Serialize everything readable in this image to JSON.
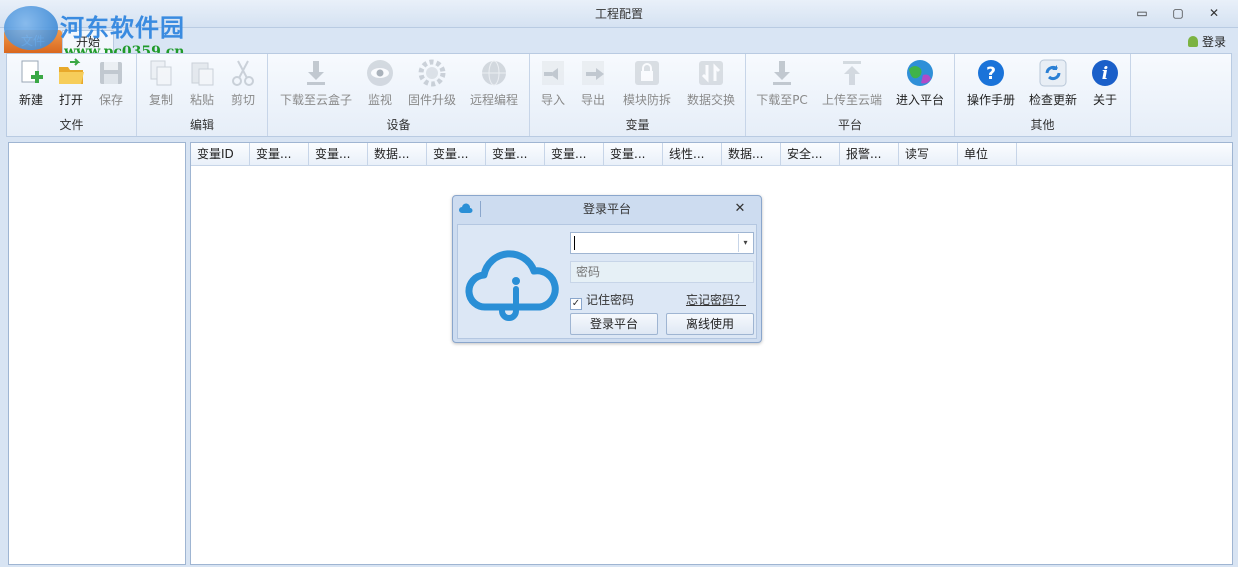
{
  "window": {
    "title": "工程配置",
    "controls": {
      "minimize": "▭",
      "maximize": "▢",
      "close": "✕"
    }
  },
  "watermark": {
    "title": "河东软件园",
    "url": "www.pc0359.cn"
  },
  "tabs": {
    "file": "文件",
    "home": "开始"
  },
  "login_link": "登录",
  "ribbon": {
    "groups": [
      {
        "label": "文件",
        "buttons": [
          {
            "label": "新建",
            "icon": "new-doc-icon"
          },
          {
            "label": "打开",
            "icon": "folder-open-icon"
          },
          {
            "label": "保存",
            "icon": "save-icon"
          }
        ]
      },
      {
        "label": "编辑",
        "buttons": [
          {
            "label": "复制",
            "icon": "copy-icon"
          },
          {
            "label": "粘贴",
            "icon": "paste-icon"
          },
          {
            "label": "剪切",
            "icon": "scissors-icon"
          }
        ]
      },
      {
        "label": "设备",
        "buttons": [
          {
            "label": "下载至云盒子",
            "icon": "download-icon"
          },
          {
            "label": "监视",
            "icon": "eye-icon"
          },
          {
            "label": "固件升级",
            "icon": "gear-icon"
          },
          {
            "label": "远程编程",
            "icon": "globe-icon"
          }
        ]
      },
      {
        "label": "变量",
        "buttons": [
          {
            "label": "导入",
            "icon": "import-icon"
          },
          {
            "label": "导出",
            "icon": "export-icon"
          },
          {
            "label": "模块防拆",
            "icon": "lock-icon"
          },
          {
            "label": "数据交换",
            "icon": "exchange-icon"
          }
        ]
      },
      {
        "label": "平台",
        "buttons": [
          {
            "label": "下载至PC",
            "icon": "download-icon"
          },
          {
            "label": "上传至云端",
            "icon": "upload-icon"
          },
          {
            "label": "进入平台",
            "icon": "platform-icon"
          }
        ]
      },
      {
        "label": "其他",
        "buttons": [
          {
            "label": "操作手册",
            "icon": "help-icon"
          },
          {
            "label": "检查更新",
            "icon": "refresh-icon"
          },
          {
            "label": "关于",
            "icon": "info-icon"
          }
        ]
      }
    ]
  },
  "grid": {
    "columns": [
      "变量ID",
      "变量...",
      "变量...",
      "数据...",
      "变量...",
      "变量...",
      "变量...",
      "变量...",
      "线性...",
      "数据...",
      "安全...",
      "报警...",
      "读写",
      "单位"
    ]
  },
  "login_dialog": {
    "title": "登录平台",
    "close": "✕",
    "username_value": "",
    "password_placeholder": "密码",
    "remember_label": "记住密码",
    "remember_checked": true,
    "check_mark": "✓",
    "forgot_label": "忘记密码？",
    "login_button": "登录平台",
    "offline_button": "离线使用",
    "dropdown_arrow": "▾"
  },
  "colors": {
    "file_tab": "#e37a2e",
    "cloud_blue": "#2a8fd6",
    "help_blue": "#1a73d9"
  }
}
